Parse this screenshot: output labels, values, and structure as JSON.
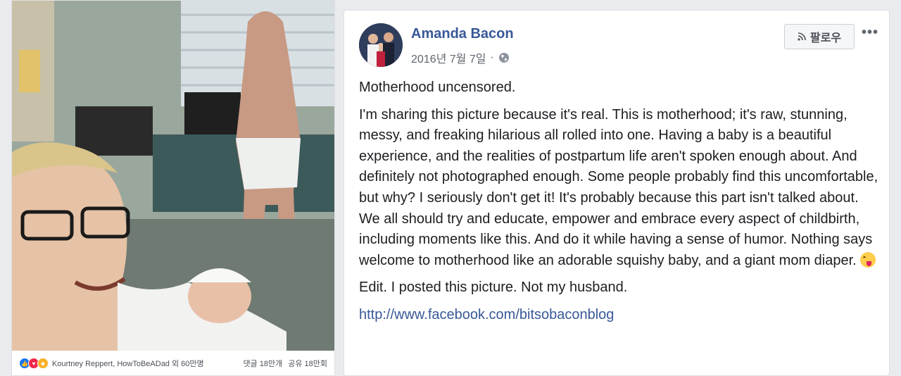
{
  "photo_card": {
    "reactions_names": "Kourtney Reppert, HowToBeADad 외 60만명",
    "comments": "댓글 18만개",
    "shares": "공유 18만회"
  },
  "post": {
    "author": "Amanda Bacon",
    "date": "2016년 7월 7일",
    "separator": "·",
    "follow_label": "팔로우",
    "more_label": "•••",
    "paragraph1": "Motherhood uncensored.",
    "paragraph2": "I'm sharing this picture because it's real. This is motherhood; it's raw, stunning, messy, and freaking hilarious all rolled into one. Having a baby is a beautiful experience, and the realities of postpartum life aren't spoken enough about. And definitely not photographed enough. Some people probably find this uncomfortable, but why? I seriously don't get it! It's probably because this part isn't talked about. We all should try and educate, empower and embrace every aspect of childbirth, including moments like this. And do it while having a sense of humor. Nothing says welcome to motherhood like an adorable squishy baby, and a giant mom diaper.",
    "paragraph3": "Edit. I posted this picture. Not my husband.",
    "link": "http://www.facebook.com/bitsobaconblog"
  },
  "icons": {
    "globe": "globe-icon",
    "rss": "rss-icon",
    "emoji": "tongue-wink-emoji-icon",
    "reactions": [
      "like-icon",
      "love-icon",
      "haha-icon"
    ]
  },
  "colors": {
    "link": "#385898",
    "background": "#e9ebee",
    "like": "#1877f2",
    "love": "#f0284a",
    "haha": "#f7b125"
  }
}
